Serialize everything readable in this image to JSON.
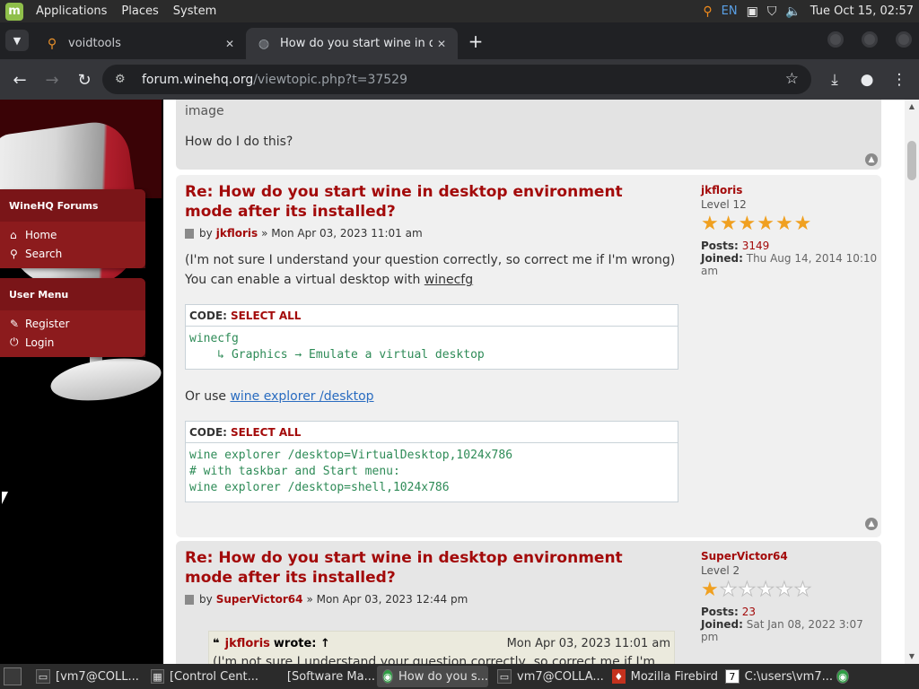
{
  "system_panel": {
    "menus": [
      "Applications",
      "Places",
      "System"
    ],
    "lang": "EN",
    "clock": "Tue Oct 15, 02:57"
  },
  "browser": {
    "tabs": [
      {
        "title": "voidtools",
        "icon": "search-favicon"
      },
      {
        "title": "How do you start wine in de",
        "icon": "globe-favicon"
      }
    ],
    "url_host": "forum.winehq.org",
    "url_path": "/viewtopic.php?t=37529"
  },
  "sidebar": {
    "forums_title": "WineHQ Forums",
    "forums_links": [
      "Home",
      "Search"
    ],
    "user_title": "User Menu",
    "user_links": [
      "Register",
      "Login"
    ]
  },
  "post0": {
    "image_alt": "image",
    "text": "How do I do this?"
  },
  "post1": {
    "title": "Re: How do you start wine in desktop environment mode after its installed?",
    "by": "by",
    "author": "jkfloris",
    "date": "» Mon Apr 03, 2023 11:01 am",
    "text1": "(I'm not sure I understand your question correctly, so correct me if I'm wrong)",
    "text2_prefix": "You can enable a virtual desktop with ",
    "text2_link": "winecfg",
    "code1_label": "CODE:",
    "code1_select": "SELECT ALL",
    "code1": "winecfg\n    ↳ Graphics → Emulate a virtual desktop",
    "text3_prefix": "Or use ",
    "text3_link": "wine explorer /desktop",
    "code2_label": "CODE:",
    "code2_select": "SELECT ALL",
    "code2": "wine explorer /desktop=VirtualDesktop,1024x786\n# with taskbar and Start menu:\nwine explorer /desktop=shell,1024x786",
    "profile": {
      "username": "jkfloris",
      "rank": "Level 12",
      "stars_filled": 6,
      "stars_total": 6,
      "posts_label": "Posts:",
      "posts": "3149",
      "joined_label": "Joined:",
      "joined": "Thu Aug 14, 2014 10:10 am"
    }
  },
  "post2": {
    "title": "Re: How do you start wine in desktop environment mode after its installed?",
    "by": "by",
    "author": "SuperVictor64",
    "date": "» Mon Apr 03, 2023 12:44 pm",
    "quote_author": "jkfloris",
    "quote_suffix": "wrote: ↑",
    "quote_date": "Mon Apr 03, 2023 11:01 am",
    "quote_text": "(I'm not sure I understand your question correctly, so correct me if I'm wrong)",
    "profile": {
      "username": "SuperVictor64",
      "rank": "Level 2",
      "stars_filled": 1,
      "stars_total": 6,
      "posts_label": "Posts:",
      "posts": "23",
      "joined_label": "Joined:",
      "joined": "Sat Jan 08, 2022 3:07 pm"
    }
  },
  "taskbar": {
    "items": [
      "[vm7@COLL...",
      "[Control Cent...",
      "[Software Ma...",
      "How do you s...",
      "vm7@COLLA...",
      "Mozilla Firebird",
      "C:\\users\\vm7..."
    ]
  }
}
